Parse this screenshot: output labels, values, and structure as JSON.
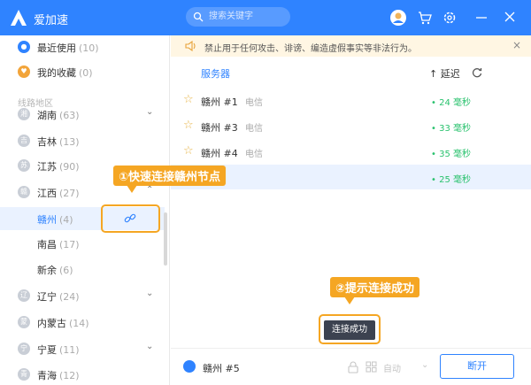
{
  "app": {
    "title": "爱加速"
  },
  "search": {
    "placeholder": "搜索关键字"
  },
  "sidebar": {
    "items": [
      {
        "label": "最近使用",
        "count": "(10)"
      },
      {
        "label": "我的收藏",
        "count": "(0)"
      }
    ],
    "section_label": "线路地区",
    "regions": [
      {
        "label": "湖南",
        "count": "(63)",
        "icon": "湘"
      },
      {
        "label": "吉林",
        "count": "(13)",
        "icon": "吉"
      },
      {
        "label": "江苏",
        "count": "(90)",
        "icon": "苏"
      },
      {
        "label": "江西",
        "count": "(27)",
        "icon": "赣"
      },
      {
        "label": "赣州",
        "count": "(4)"
      },
      {
        "label": "南昌",
        "count": "(17)"
      },
      {
        "label": "新余",
        "count": "(6)"
      },
      {
        "label": "辽宁",
        "count": "(24)",
        "icon": "辽"
      },
      {
        "label": "内蒙古",
        "count": "(14)",
        "icon": "蒙"
      },
      {
        "label": "宁夏",
        "count": "(11)",
        "icon": "宁"
      },
      {
        "label": "青海",
        "count": "(12)",
        "icon": "青"
      }
    ]
  },
  "notice": {
    "text": "禁止用于任何攻击、诽谤、编造虚假事实等非法行为。"
  },
  "table": {
    "col_server": "服务器",
    "col_latency": "↑ 延迟",
    "rows": [
      {
        "server": "赣州 #1",
        "isp": "电信",
        "latency": "• 24 毫秒"
      },
      {
        "server": "赣州 #3",
        "isp": "电信",
        "latency": "• 33 毫秒"
      },
      {
        "server": "赣州 #4",
        "isp": "电信",
        "latency": "• 35 毫秒"
      },
      {
        "server": "",
        "isp": "",
        "latency": "• 25 毫秒"
      }
    ]
  },
  "bottom": {
    "node": "赣州 #5",
    "auto": "自动",
    "disconnect": "断开"
  },
  "toast": "连接成功",
  "annotations": {
    "step1": "①快速连接赣州节点",
    "step2": "②提示连接成功"
  },
  "colors": {
    "brand": "#2f83ff",
    "annotation": "#f5a623",
    "latency": "#2ac26e"
  }
}
